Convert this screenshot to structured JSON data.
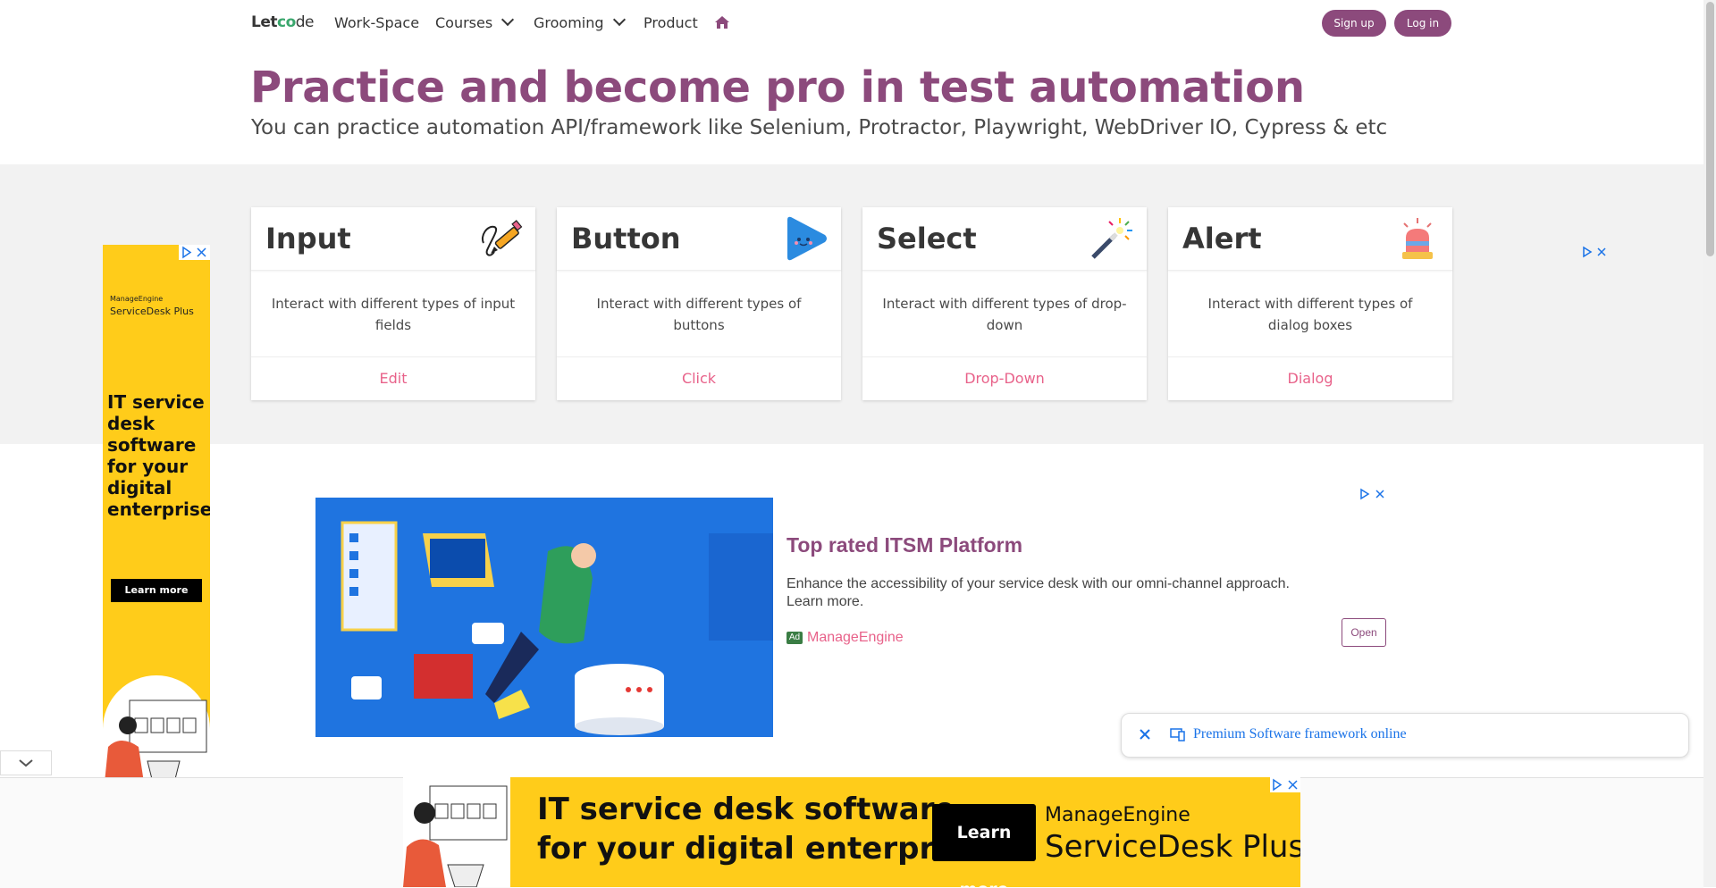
{
  "nav": {
    "brand_let": "Let",
    "brand_c": "c",
    "brand_o": "o",
    "brand_de": "de",
    "workspace": "Work-Space",
    "courses": "Courses",
    "grooming": "Grooming",
    "product": "Product",
    "home_icon": "home-icon",
    "signup": "Sign up",
    "login": "Log in"
  },
  "hero": {
    "title": "Practice and become pro in test automation",
    "subtitle": "You can practice automation API/framework like Selenium, Protractor, Playwright, WebDriver IO, Cypress & etc"
  },
  "cards": [
    {
      "title": "Input",
      "icon": "pencil-icon",
      "body": "Interact with different types of input fields",
      "link": "Edit"
    },
    {
      "title": "Button",
      "icon": "play-button-icon",
      "body": "Interact with different types of buttons",
      "link": "Click"
    },
    {
      "title": "Select",
      "icon": "magic-wand-icon",
      "body": "Interact with different types of drop-down",
      "link": "Drop-Down"
    },
    {
      "title": "Alert",
      "icon": "siren-icon",
      "body": "Interact with different types of dialog boxes",
      "link": "Dialog"
    }
  ],
  "side_ad": {
    "brand_small": "ManageEngine",
    "brand": "ServiceDesk Plus",
    "headline": "IT service desk software for your digital enterprise",
    "cta": "Learn more"
  },
  "mid_ad": {
    "title": "Top rated ITSM Platform",
    "body": "Enhance the accessibility of your service desk with our omni-channel approach. Learn more.",
    "badge": "Ad",
    "advertiser": "ManageEngine",
    "cta": "Open"
  },
  "premium": {
    "text": "Premium Software framework online"
  },
  "bottom_ad": {
    "headline_line1": "IT service desk software",
    "headline_line2": "for your digital enterprise",
    "cta": "Learn more",
    "brand_top": "ManageEngine",
    "brand_bottom": "ServiceDesk Plus"
  },
  "colors": {
    "brand_purple": "#8c4a7c",
    "link_pink": "#e8628a",
    "ad_yellow": "#ffcc1a",
    "ad_blue": "#1f74e0"
  }
}
